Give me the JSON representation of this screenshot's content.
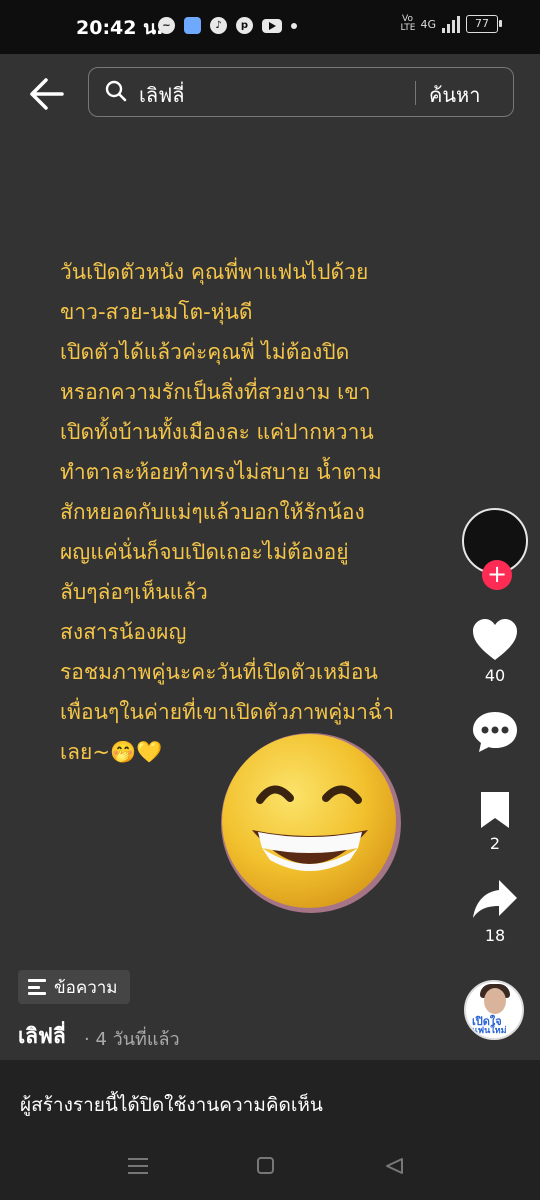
{
  "status_bar": {
    "time": "20:42 น.",
    "app_icons": [
      "messenger-icon",
      "blue-app-icon",
      "tiktok-icon",
      "pinterest-icon",
      "youtube-icon",
      "dot-icon"
    ],
    "volte": "Vo LTE",
    "network": "4G",
    "battery": "77"
  },
  "search": {
    "query": "เลิฟลี่",
    "button_label": "ค้นหา"
  },
  "post_lines": [
    "วันเปิดตัวหนัง คุณพี่พาแฟนไปด้วย",
    "ขาว-สวย-นมโต-หุ่นดี",
    "เปิดตัวได้แล้วค่ะคุณพี่ ไม่ต้องปิด",
    "หรอกความรักเป็นสิ่งที่สวยงาม เขา",
    "เปิดทั้งบ้านทั้งเมืองละ แค่ปากหวาน",
    "ทำตาละห้อยทำทรงไม่สบาย น้ำตาม",
    "สักหยอดกับแม่ๆแล้วบอกให้รักน้อง",
    "ผญแค่นั่นก็จบเปิดเถอะไม่ต้องอยู่",
    "ลับๆล่อๆเห็นแล้ว",
    "สงสารน้องผญ",
    "รอชมภาพคู่นะคะวันที่เปิดตัวเหมือน",
    "เพื่อนๆในค่ายที่เขาเปิดตัวภาพคู่มาฉ่ำ",
    "เลย~🤭💛"
  ],
  "actions": {
    "likes": "40",
    "comments": "",
    "saves": "2",
    "shares": "18",
    "follow_symbol": "+"
  },
  "badge_label": "ข้อความ",
  "author": "เลิฟลี่",
  "post_meta": "· 4 วันที่แล้ว",
  "music_thumb": {
    "line1": "เปิดใจ",
    "line2": "แฟนใหม่"
  },
  "comments_disabled_text": "ผู้สร้างรายนี้ได้ปิดใช้งานความคิดเห็น",
  "colors": {
    "background": "#333333",
    "text_accent": "#f5c64a",
    "follow_badge": "#fe2c55"
  }
}
